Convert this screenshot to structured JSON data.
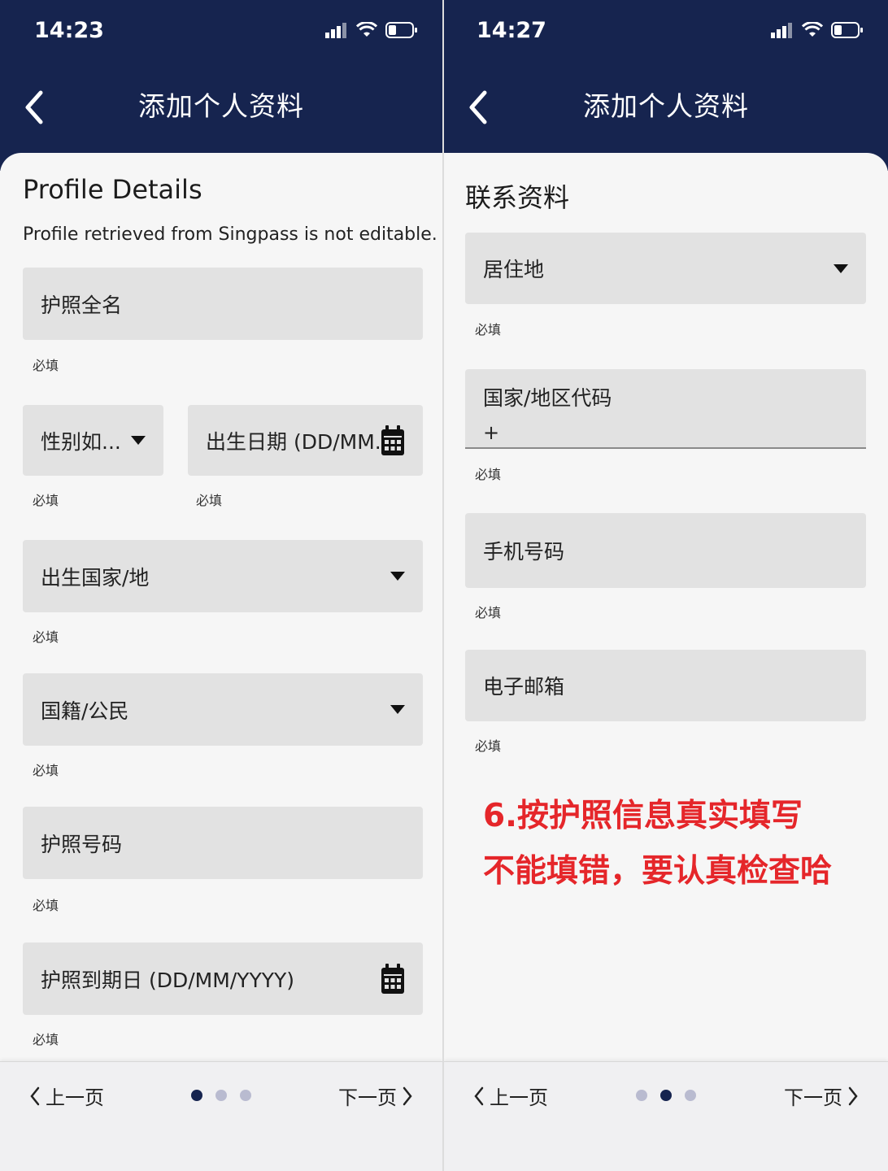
{
  "colors": {
    "header_bg": "#16244f",
    "field_bg": "#e2e2e2",
    "annotation_red": "#e5262a",
    "dot_active": "#16244f",
    "dot_inactive": "#b9bbd0"
  },
  "left": {
    "status_time": "14:23",
    "header_title": "添加个人资料",
    "section_title": "Profile Details",
    "subtitle": "Profile retrieved from Singpass is not editable.",
    "fields": [
      {
        "label": "护照全名",
        "helper": "必填",
        "icon": "none"
      },
      {
        "label": "性别如...",
        "helper": "必填",
        "icon": "dropdown-caret"
      },
      {
        "label": "出生日期 (DD/MM...",
        "helper": "必填",
        "icon": "calendar-icon"
      },
      {
        "label": "出生国家/地",
        "helper": "必填",
        "icon": "dropdown-caret"
      },
      {
        "label": "国籍/公民",
        "helper": "必填",
        "icon": "dropdown-caret"
      },
      {
        "label": "护照号码",
        "helper": "必填",
        "icon": "none"
      },
      {
        "label": "护照到期日 (DD/MM/YYYY)",
        "helper": "必填",
        "icon": "calendar-icon"
      }
    ],
    "footer": {
      "prev": "上一页",
      "next": "下一页",
      "active_page": 1,
      "total_pages": 3
    }
  },
  "right": {
    "status_time": "14:27",
    "header_title": "添加个人资料",
    "section_title": "联系资料",
    "fields": [
      {
        "label": "居住地",
        "helper": "必填",
        "icon": "dropdown-caret"
      },
      {
        "label": "国家/地区代码",
        "sub": "+",
        "helper": "必填",
        "icon": "none"
      },
      {
        "label": "手机号码",
        "helper": "必填",
        "icon": "none"
      },
      {
        "label": "电子邮箱",
        "helper": "必填",
        "icon": "none"
      }
    ],
    "annotation": {
      "line1": "6.按护照信息真实填写",
      "line2": "不能填错，要认真检查哈"
    },
    "footer": {
      "prev": "上一页",
      "next": "下一页",
      "active_page": 2,
      "total_pages": 3
    }
  }
}
